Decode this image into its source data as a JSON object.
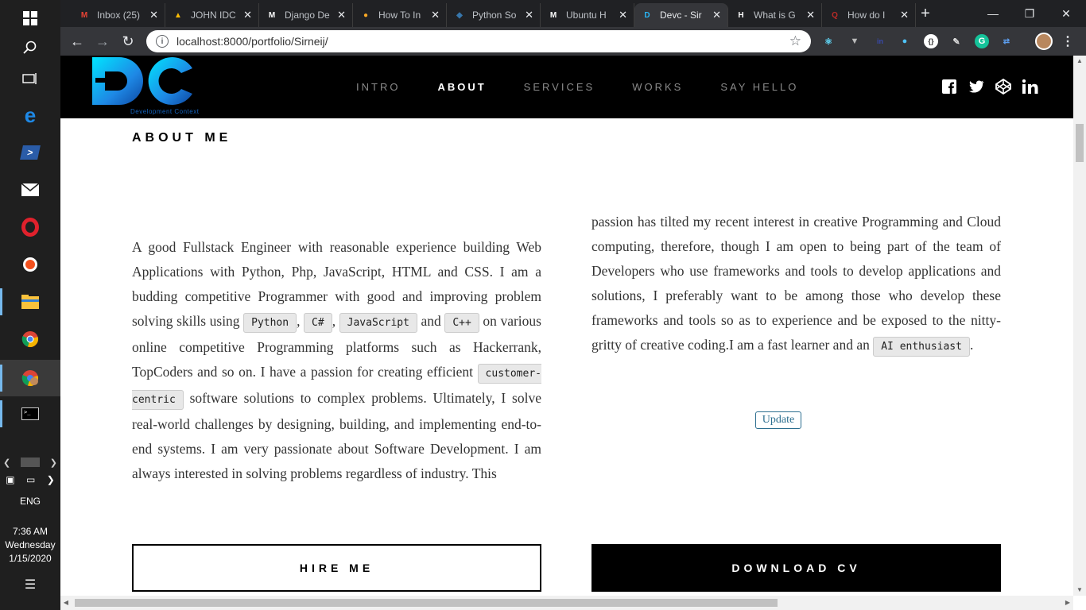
{
  "taskbar": {
    "icons": [
      "windows-start",
      "search",
      "task-view",
      "edge",
      "powershell",
      "mail",
      "opera",
      "ubuntu",
      "file-explorer",
      "chrome",
      "chrome-profile",
      "terminal"
    ],
    "language": "ENG",
    "time": "7:36 AM",
    "day": "Wednesday",
    "date": "1/15/2020"
  },
  "tabs": [
    {
      "title": "Inbox (25)",
      "icon": "gmail-icon",
      "color": "#ea4335",
      "glyph": "M"
    },
    {
      "title": "JOHN IDC",
      "icon": "drive-icon",
      "color": "#fbbc04",
      "glyph": "▲"
    },
    {
      "title": "Django De",
      "icon": "medium-icon",
      "color": "#ffffff",
      "glyph": "M"
    },
    {
      "title": "How To In",
      "icon": "howto-icon",
      "color": "#f9a825",
      "glyph": "●"
    },
    {
      "title": "Python So",
      "icon": "python-icon",
      "color": "#3776ab",
      "glyph": "◆"
    },
    {
      "title": "Ubuntu H",
      "icon": "medium-icon",
      "color": "#ffffff",
      "glyph": "M"
    },
    {
      "title": "Devc - Sir",
      "icon": "devc-icon",
      "color": "#29b6f6",
      "glyph": "D"
    },
    {
      "title": "What is G",
      "icon": "htg-icon",
      "color": "#ffffff",
      "glyph": "H"
    },
    {
      "title": "How do I",
      "icon": "quora-icon",
      "color": "#b92b27",
      "glyph": "Q"
    }
  ],
  "address_bar": {
    "url": "localhost:8000/portfolio/Sirneij/"
  },
  "site": {
    "logo_sub": "Development Context",
    "nav": [
      {
        "label": "INTRO",
        "current": false
      },
      {
        "label": "ABOUT",
        "current": true
      },
      {
        "label": "SERVICES",
        "current": false
      },
      {
        "label": "WORKS",
        "current": false
      },
      {
        "label": "SAY HELLO",
        "current": false
      }
    ],
    "socials": [
      "facebook-icon",
      "twitter-icon",
      "codepen-icon",
      "linkedin-icon"
    ]
  },
  "about": {
    "title": "ABOUT ME",
    "left_text": {
      "p1": "A good Fullstack Engineer with reasonable experience building Web Applications with Python, Php, JavaScript, HTML and CSS. I am a budding competitive Programmer with good and improving problem solving skills using ",
      "tag1": "Python",
      "s1": ", ",
      "tag2": "C#",
      "s2": ", ",
      "tag3": "JavaScript",
      "s3": " and ",
      "tag4": "C++",
      "p2": " on various online competitive Programming platforms such as Hackerrank, TopCoders and so on. I have a passion for creating efficient ",
      "tag5": "customer-centric",
      "p3": " software solutions to complex problems. Ultimately, I solve real-world challenges by designing, building, and implementing end-to-end systems. I am very passionate about Software Development. I am always interested in solving problems regardless of industry. This"
    },
    "right_text": {
      "p1": "passion has tilted my recent interest in creative Programming and Cloud computing, therefore, though I am open to being part of the team of Developers who use frameworks and tools to develop applications and solutions, I preferably want to be among those who develop these frameworks and tools so as to experience and be exposed to the nitty-gritty of creative coding.I am a fast learner and an ",
      "tag1": "AI enthusiast",
      "p2": "."
    },
    "update_label": "Update",
    "hire_label": "HIRE ME",
    "download_label": "DOWNLOAD CV"
  }
}
